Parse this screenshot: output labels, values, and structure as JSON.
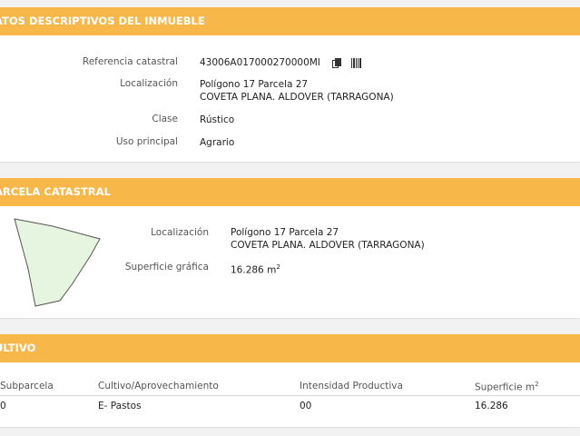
{
  "datos": {
    "title": "ATOS DESCRIPTIVOS DEL INMUEBLE",
    "fields": [
      {
        "label": "Referencia catastral",
        "value": "43006A017000270000MI"
      },
      {
        "label": "Localización",
        "line1": "Polígono 17 Parcela 27",
        "line2": "COVETA PLANA. ALDOVER (TARRAGONA)"
      },
      {
        "label": "Clase",
        "value": "Rústico"
      },
      {
        "label": "Uso principal",
        "value": "Agrario"
      }
    ],
    "icons": [
      "copy-icon",
      "barcode-icon"
    ]
  },
  "parcela": {
    "title": "ARCELA CATASTRAL",
    "localizacion_label": "Localización",
    "localizacion_line1": "Polígono 17 Parcela 27",
    "localizacion_line2": "COVETA PLANA. ALDOVER (TARRAGONA)",
    "superficie_label": "Superficie gráfica",
    "superficie_value": "16.286 m",
    "superficie_exp": "2",
    "shape_fill": "#e6f5df"
  },
  "cultivo": {
    "title": "ULTIVO",
    "headers": {
      "subparcela": "Subparcela",
      "cultivo": "Cultivo/Aprovechamiento",
      "intensidad": "Intensidad Productiva",
      "superficie": "Superficie m",
      "superficie_exp": "2"
    },
    "rows": [
      {
        "subparcela": "0",
        "cultivo": "E- Pastos",
        "intensidad": "00",
        "superficie": "16.286"
      }
    ]
  },
  "colors": {
    "header": "#f7b749",
    "background": "#f2f2f2"
  }
}
